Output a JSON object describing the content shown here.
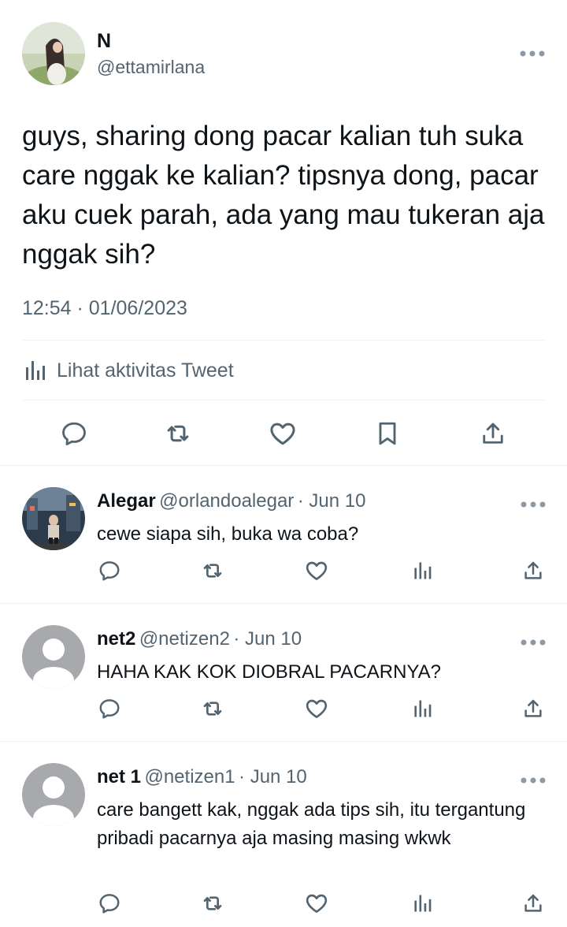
{
  "main_tweet": {
    "author_name": "N",
    "author_handle": "@ettamirlana",
    "text": "guys, sharing dong pacar kalian tuh suka care nggak ke kalian? tipsnya dong, pacar aku cuek parah, ada yang mau tukeran aja nggak sih?",
    "timestamp": "12:54 · 01/06/2023",
    "activity_label": "Lihat aktivitas Tweet",
    "actions": [
      "reply-icon",
      "retweet-icon",
      "like-icon",
      "bookmark-icon",
      "share-icon"
    ]
  },
  "replies": [
    {
      "name": "Alegar",
      "handle": "@orlandoalegar",
      "date": "· Jun 10",
      "text": "cewe siapa sih, buka wa coba?",
      "avatar": "photo"
    },
    {
      "name": "net2",
      "handle": "@netizen2",
      "date": "· Jun 10",
      "text": "HAHA KAK KOK DIOBRAL PACARNYA?",
      "avatar": "default"
    },
    {
      "name": "net 1",
      "handle": "@netizen1",
      "date": "· Jun 10",
      "text": "care bangett kak, nggak ada tips sih, itu tergantung pribadi pacarnya aja masing masing wkwk",
      "avatar": "default"
    }
  ],
  "colors": {
    "text": "#0f1419",
    "secondary": "#536471",
    "divider": "#eff3f4",
    "default_avatar_bg": "#a7a9ac"
  }
}
